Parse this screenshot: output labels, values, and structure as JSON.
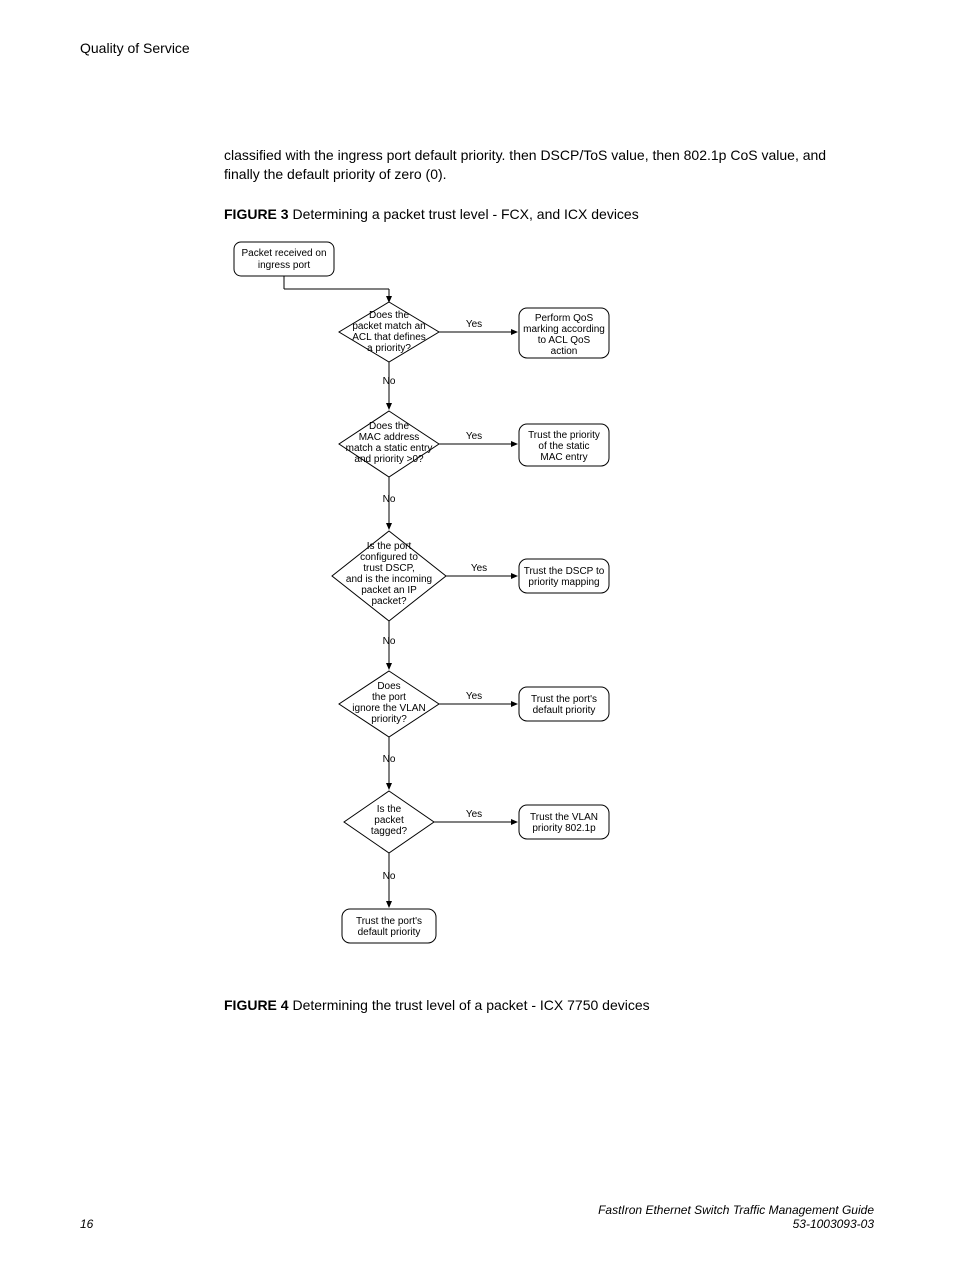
{
  "header": {
    "title": "Quality of Service"
  },
  "paragraph": "classified with the ingress port default priority. then DSCP/ToS value, then 802.1p CoS value, and finally the default priority of zero (0).",
  "fig3": {
    "label": "FIGURE 3",
    "caption": " Determining a packet trust level - FCX, and ICX devices"
  },
  "fig4": {
    "label": "FIGURE 4",
    "caption": " Determining the trust level of a packet - ICX 7750 devices"
  },
  "chart_data": {
    "type": "flowchart",
    "start": "Packet received on ingress port",
    "decisions": [
      {
        "question": "Does the packet match an ACL that defines a priority?",
        "yes_action": "Perform QoS marking according to ACL QoS action",
        "no": "next"
      },
      {
        "question": "Does the MAC address match a static entry and priority >0?",
        "yes_action": "Trust the priority of the static MAC entry",
        "no": "next"
      },
      {
        "question": "Is the port configured to trust DSCP, and is the incoming packet an IP packet?",
        "yes_action": "Trust the DSCP to priority mapping",
        "no": "next"
      },
      {
        "question": "Does the port ignore the VLAN priority?",
        "yes_action": "Trust the port's default priority",
        "no": "next"
      },
      {
        "question": "Is the packet tagged?",
        "yes_action": "Trust the VLAN priority 802.1p",
        "no": "next"
      }
    ],
    "end": "Trust the port's default priority",
    "labels": {
      "yes": "Yes",
      "no": "No"
    }
  },
  "flow": {
    "start_l1": "Packet received on",
    "start_l2": "ingress port",
    "d1_l1": "Does the",
    "d1_l2": "packet match an",
    "d1_l3": "ACL that defines",
    "d1_l4": "a priority?",
    "a1_l1": "Perform QoS",
    "a1_l2": "marking according",
    "a1_l3": "to ACL QoS",
    "a1_l4": "action",
    "d2_l1": "Does the",
    "d2_l2": "MAC address",
    "d2_l3": "match a static entry",
    "d2_l4": "and priority >0?",
    "a2_l1": "Trust the priority",
    "a2_l2": "of the static",
    "a2_l3": "MAC entry",
    "d3_l1": "Is the port",
    "d3_l2": "configured to",
    "d3_l3": "trust DSCP,",
    "d3_l4": "and is the incoming",
    "d3_l5": "packet an IP",
    "d3_l6": "packet?",
    "a3_l1": "Trust the DSCP to",
    "a3_l2": "priority mapping",
    "d4_l1": "Does",
    "d4_l2": "the port",
    "d4_l3": "ignore the VLAN",
    "d4_l4": "priority?",
    "a4_l1": "Trust the port's",
    "a4_l2": "default priority",
    "d5_l1": "Is the",
    "d5_l2": "packet",
    "d5_l3": "tagged?",
    "a5_l1": "Trust the VLAN",
    "a5_l2": "priority 802.1p",
    "end_l1": "Trust the port's",
    "end_l2": "default priority",
    "yes": "Yes",
    "no": "No"
  },
  "footer": {
    "page": "16",
    "title": "FastIron Ethernet Switch Traffic Management Guide",
    "docnum": "53-1003093-03"
  }
}
